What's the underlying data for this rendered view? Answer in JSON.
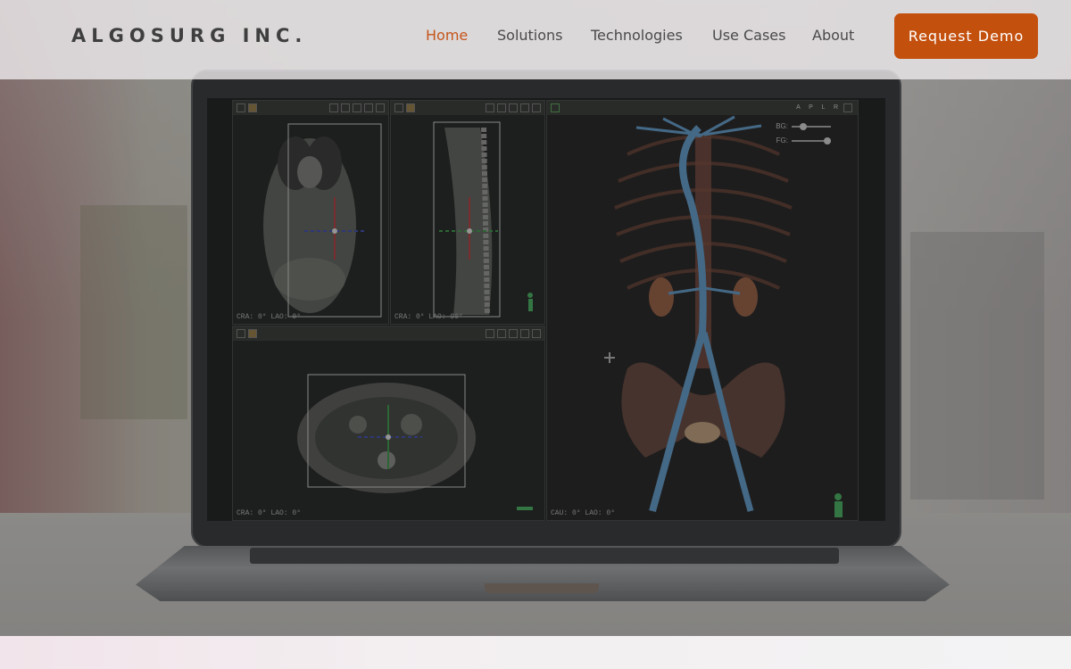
{
  "brand": {
    "logo_text": "ALGOSURG INC.",
    "accent_color": "#c4500e"
  },
  "nav": {
    "items": [
      {
        "label": "Home",
        "active": true
      },
      {
        "label": "Solutions",
        "active": false
      },
      {
        "label": "Technologies",
        "active": false
      },
      {
        "label": "Use Cases",
        "active": false
      },
      {
        "label": "About",
        "active": false
      }
    ],
    "cta_label": "Request Demo"
  },
  "viewer": {
    "coronal_label": "CRA: 0° LAO: 0°",
    "sagittal_label": "CRA: 0° LAO: 90°",
    "axial_label": "CRA: 0° LAO: 0°",
    "volume_label": "CAU: 0° LAO: 0°",
    "orientation_buttons": [
      "A",
      "P",
      "L",
      "R"
    ],
    "bg_label": "BG:",
    "fg_label": "FG:",
    "bg_level": 0.3,
    "fg_level": 0.9
  },
  "icons": [
    "human-figure-icon",
    "crosshair-icon",
    "window-icon",
    "layout-icon"
  ]
}
